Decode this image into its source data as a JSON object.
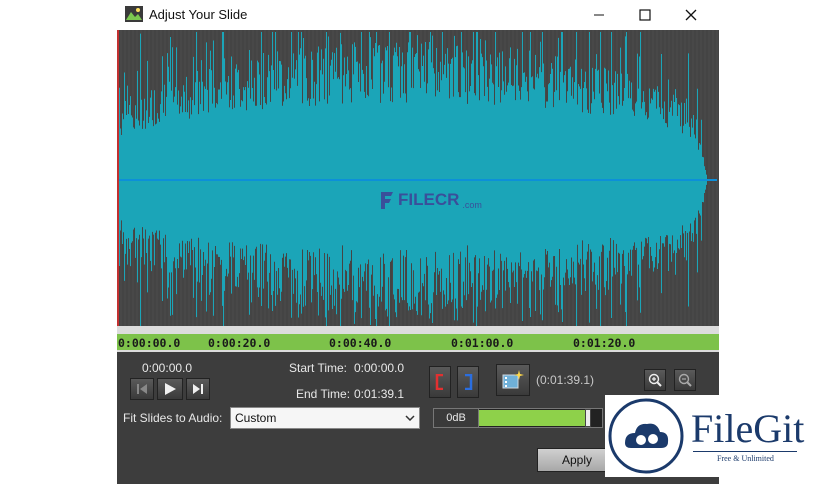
{
  "window": {
    "title": "Adjust Your Slide"
  },
  "watermark": {
    "text": "FILECR",
    "suffix": ".com"
  },
  "timeline": {
    "labels": [
      "0:00:00.0",
      "0:00:20.0",
      "0:00:40.0",
      "0:01:00.0",
      "0:01:20.0"
    ]
  },
  "playback": {
    "position": "0:00:00.0"
  },
  "times": {
    "start_label": "Start Time:",
    "start_value": "0:00:00.0",
    "end_label": "End Time:",
    "end_value": "0:01:39.1",
    "duration": "(0:01:39.1)"
  },
  "fit": {
    "label": "Fit Slides to Audio:",
    "selected": "Custom"
  },
  "volume": {
    "label": "0dB",
    "level": 0.88
  },
  "apply_label": "Apply",
  "brand": {
    "name": "FileGit",
    "tagline": "Free & Unlimited"
  },
  "colors": {
    "wave": "#1ba5b8",
    "waveBg": "#444444",
    "timeline": "#7dc24a",
    "brand": "#1b3a6b"
  }
}
